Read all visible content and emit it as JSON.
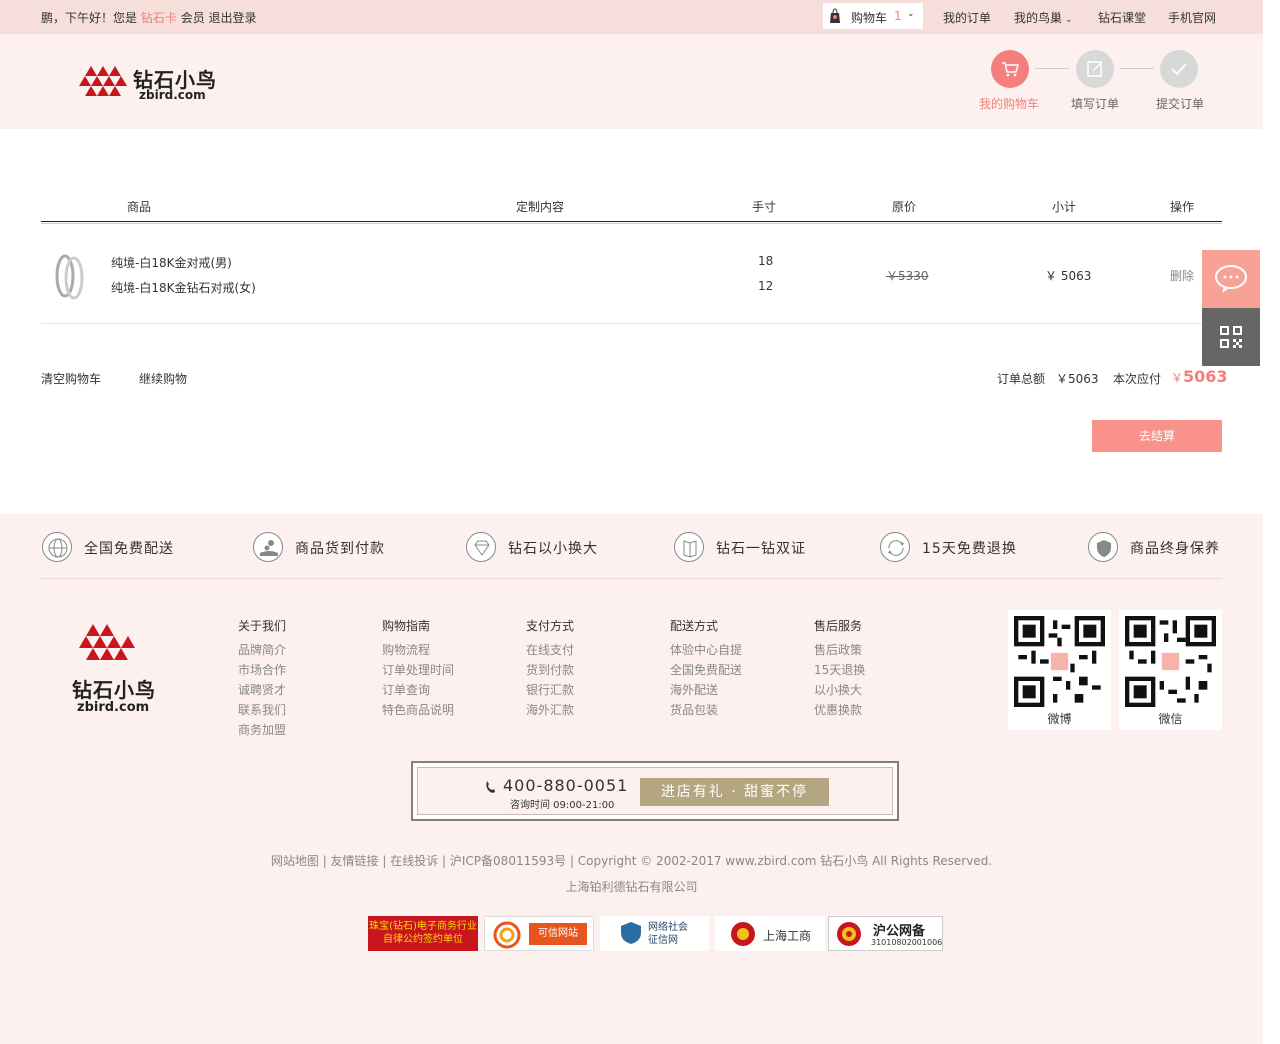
{
  "topbar": {
    "greeting": "鹏，下午好！您是",
    "member_level": "钻石卡",
    "member_suffix": "会员",
    "logout": "退出登录",
    "cart_label": "购物车",
    "cart_count": "1",
    "my_orders": "我的订单",
    "my_nest": "我的鸟巢",
    "diamond_class": "钻石课堂",
    "mobile_site": "手机官网"
  },
  "logo": {
    "cn": "钻石小鸟",
    "en": "zbird.com"
  },
  "steps": [
    {
      "label": "我的购物车",
      "active": true,
      "icon": "cart-icon"
    },
    {
      "label": "填写订单",
      "active": false,
      "icon": "edit-icon"
    },
    {
      "label": "提交订单",
      "active": false,
      "icon": "check-icon"
    }
  ],
  "table": {
    "headers": {
      "product": "商品",
      "custom": "定制内容",
      "size": "手寸",
      "orig": "原价",
      "subtotal": "小计",
      "action": "操作"
    },
    "row": {
      "items": [
        {
          "name": "纯境-白18K金对戒(男)",
          "size": "18"
        },
        {
          "name": "纯境-白18K金钻石对戒(女)",
          "size": "12"
        }
      ],
      "orig_price": "￥5330",
      "subtotal": "￥ 5063",
      "delete": "删除"
    }
  },
  "summary": {
    "clear_cart": "清空购物车",
    "continue_shopping": "继续购物",
    "order_total_label": "订单总额",
    "order_total": "￥5063",
    "payable_label": "本次应付",
    "payable_currency": "￥",
    "payable": "5063",
    "checkout": "去结算"
  },
  "services": [
    {
      "text": "全国免费配送",
      "icon": "globe-icon"
    },
    {
      "text": "商品货到付款",
      "icon": "hand-coins-icon"
    },
    {
      "text": "钻石以小换大",
      "icon": "diamond-icon"
    },
    {
      "text": "钻石一钻双证",
      "icon": "certificate-icon"
    },
    {
      "text": "15天免费退换",
      "icon": "refresh-icon"
    },
    {
      "text": "商品终身保养",
      "icon": "shield-icon"
    }
  ],
  "footer_cols": [
    {
      "title": "关于我们",
      "items": [
        "品牌简介",
        "市场合作",
        "诚聘贤才",
        "联系我们",
        "商务加盟"
      ]
    },
    {
      "title": "购物指南",
      "items": [
        "购物流程",
        "订单处理时间",
        "订单查询",
        "特色商品说明"
      ]
    },
    {
      "title": "支付方式",
      "items": [
        "在线支付",
        "货到付款",
        "银行汇款",
        "海外汇款"
      ]
    },
    {
      "title": "配送方式",
      "items": [
        "体验中心自提",
        "全国免费配送",
        "海外配送",
        "货品包装"
      ]
    },
    {
      "title": "售后服务",
      "items": [
        "售后政策",
        "15天退换",
        "以小换大",
        "优惠换款"
      ]
    }
  ],
  "qrcodes": [
    "微博",
    "微信"
  ],
  "banner": {
    "phone": "400-880-0051",
    "hours": "咨询时间 09:00-21:00",
    "promo": "进店有礼 · 甜蜜不停"
  },
  "copyright": "网站地图 | 友情链接 | 在线投诉 | 沪ICP备08011593号 | Copyright © 2002-2017 www.zbird.com 钻石小鸟 All Rights Reserved.",
  "company": "上海铂利德钻石有限公司",
  "badges": {
    "b1": "珠宝(钻石)电子商务行业自律公约签约单位",
    "b2": "可信网站",
    "b3": "网络社会征信网",
    "b4": "上海工商",
    "b5_title": "沪公网备",
    "b5_num": "31010802001006"
  },
  "colors": {
    "accent": "#f47f7c",
    "checkout": "#f8928b",
    "footer_bg": "#fcf1ef",
    "topbar_bg": "#f6dfdb"
  }
}
